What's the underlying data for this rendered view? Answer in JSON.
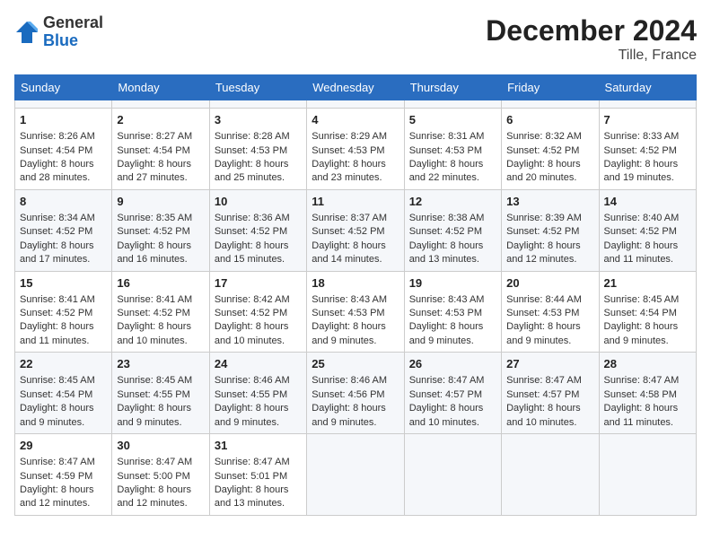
{
  "header": {
    "logo_general": "General",
    "logo_blue": "Blue",
    "month_year": "December 2024",
    "location": "Tille, France"
  },
  "calendar": {
    "days_of_week": [
      "Sunday",
      "Monday",
      "Tuesday",
      "Wednesday",
      "Thursday",
      "Friday",
      "Saturday"
    ],
    "weeks": [
      [
        {
          "day": "",
          "data": ""
        },
        {
          "day": "",
          "data": ""
        },
        {
          "day": "",
          "data": ""
        },
        {
          "day": "",
          "data": ""
        },
        {
          "day": "",
          "data": ""
        },
        {
          "day": "",
          "data": ""
        },
        {
          "day": "",
          "data": ""
        }
      ],
      [
        {
          "day": "1",
          "data": "Sunrise: 8:26 AM\nSunset: 4:54 PM\nDaylight: 8 hours and 28 minutes."
        },
        {
          "day": "2",
          "data": "Sunrise: 8:27 AM\nSunset: 4:54 PM\nDaylight: 8 hours and 27 minutes."
        },
        {
          "day": "3",
          "data": "Sunrise: 8:28 AM\nSunset: 4:53 PM\nDaylight: 8 hours and 25 minutes."
        },
        {
          "day": "4",
          "data": "Sunrise: 8:29 AM\nSunset: 4:53 PM\nDaylight: 8 hours and 23 minutes."
        },
        {
          "day": "5",
          "data": "Sunrise: 8:31 AM\nSunset: 4:53 PM\nDaylight: 8 hours and 22 minutes."
        },
        {
          "day": "6",
          "data": "Sunrise: 8:32 AM\nSunset: 4:52 PM\nDaylight: 8 hours and 20 minutes."
        },
        {
          "day": "7",
          "data": "Sunrise: 8:33 AM\nSunset: 4:52 PM\nDaylight: 8 hours and 19 minutes."
        }
      ],
      [
        {
          "day": "8",
          "data": "Sunrise: 8:34 AM\nSunset: 4:52 PM\nDaylight: 8 hours and 17 minutes."
        },
        {
          "day": "9",
          "data": "Sunrise: 8:35 AM\nSunset: 4:52 PM\nDaylight: 8 hours and 16 minutes."
        },
        {
          "day": "10",
          "data": "Sunrise: 8:36 AM\nSunset: 4:52 PM\nDaylight: 8 hours and 15 minutes."
        },
        {
          "day": "11",
          "data": "Sunrise: 8:37 AM\nSunset: 4:52 PM\nDaylight: 8 hours and 14 minutes."
        },
        {
          "day": "12",
          "data": "Sunrise: 8:38 AM\nSunset: 4:52 PM\nDaylight: 8 hours and 13 minutes."
        },
        {
          "day": "13",
          "data": "Sunrise: 8:39 AM\nSunset: 4:52 PM\nDaylight: 8 hours and 12 minutes."
        },
        {
          "day": "14",
          "data": "Sunrise: 8:40 AM\nSunset: 4:52 PM\nDaylight: 8 hours and 11 minutes."
        }
      ],
      [
        {
          "day": "15",
          "data": "Sunrise: 8:41 AM\nSunset: 4:52 PM\nDaylight: 8 hours and 11 minutes."
        },
        {
          "day": "16",
          "data": "Sunrise: 8:41 AM\nSunset: 4:52 PM\nDaylight: 8 hours and 10 minutes."
        },
        {
          "day": "17",
          "data": "Sunrise: 8:42 AM\nSunset: 4:52 PM\nDaylight: 8 hours and 10 minutes."
        },
        {
          "day": "18",
          "data": "Sunrise: 8:43 AM\nSunset: 4:53 PM\nDaylight: 8 hours and 9 minutes."
        },
        {
          "day": "19",
          "data": "Sunrise: 8:43 AM\nSunset: 4:53 PM\nDaylight: 8 hours and 9 minutes."
        },
        {
          "day": "20",
          "data": "Sunrise: 8:44 AM\nSunset: 4:53 PM\nDaylight: 8 hours and 9 minutes."
        },
        {
          "day": "21",
          "data": "Sunrise: 8:45 AM\nSunset: 4:54 PM\nDaylight: 8 hours and 9 minutes."
        }
      ],
      [
        {
          "day": "22",
          "data": "Sunrise: 8:45 AM\nSunset: 4:54 PM\nDaylight: 8 hours and 9 minutes."
        },
        {
          "day": "23",
          "data": "Sunrise: 8:45 AM\nSunset: 4:55 PM\nDaylight: 8 hours and 9 minutes."
        },
        {
          "day": "24",
          "data": "Sunrise: 8:46 AM\nSunset: 4:55 PM\nDaylight: 8 hours and 9 minutes."
        },
        {
          "day": "25",
          "data": "Sunrise: 8:46 AM\nSunset: 4:56 PM\nDaylight: 8 hours and 9 minutes."
        },
        {
          "day": "26",
          "data": "Sunrise: 8:47 AM\nSunset: 4:57 PM\nDaylight: 8 hours and 10 minutes."
        },
        {
          "day": "27",
          "data": "Sunrise: 8:47 AM\nSunset: 4:57 PM\nDaylight: 8 hours and 10 minutes."
        },
        {
          "day": "28",
          "data": "Sunrise: 8:47 AM\nSunset: 4:58 PM\nDaylight: 8 hours and 11 minutes."
        }
      ],
      [
        {
          "day": "29",
          "data": "Sunrise: 8:47 AM\nSunset: 4:59 PM\nDaylight: 8 hours and 12 minutes."
        },
        {
          "day": "30",
          "data": "Sunrise: 8:47 AM\nSunset: 5:00 PM\nDaylight: 8 hours and 12 minutes."
        },
        {
          "day": "31",
          "data": "Sunrise: 8:47 AM\nSunset: 5:01 PM\nDaylight: 8 hours and 13 minutes."
        },
        {
          "day": "",
          "data": ""
        },
        {
          "day": "",
          "data": ""
        },
        {
          "day": "",
          "data": ""
        },
        {
          "day": "",
          "data": ""
        }
      ]
    ]
  }
}
